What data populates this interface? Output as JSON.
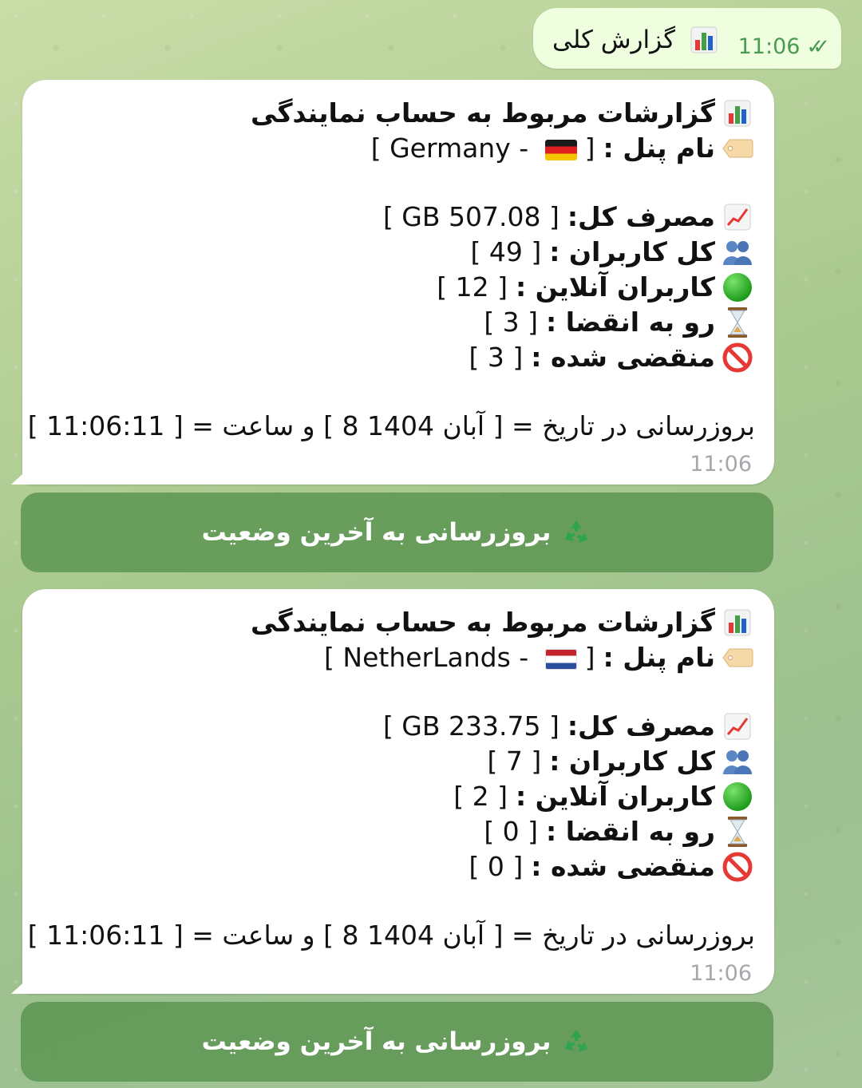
{
  "outgoing": {
    "text": "گزارش کلی",
    "icon": "bar-chart-icon",
    "time": "11:06",
    "status": "read-double-check"
  },
  "reports": [
    {
      "title": "گزارشات مربوط به حساب نمایندگی",
      "panel_label": "نام پنل :",
      "panel_name": "[ Germany - 🇩🇪 ]",
      "panel_country": "Germany",
      "panel_flag": "flag-germany-icon",
      "usage_label": "مصرف کل:",
      "usage_value": "[ GB 507.08 ]",
      "users_label": "کل کاربران :",
      "users_value": "[ 49 ]",
      "online_label": "کاربران آنلاین :",
      "online_value": "[ 12 ]",
      "expiring_label": "رو به انقضا :",
      "expiring_value": "[ 3 ]",
      "expired_label": "منقضی شده :",
      "expired_value": "[ 3 ]",
      "update_prefix": "بروزرسانی در تاریخ =",
      "update_date": "[ 8 آبان 1404 ]",
      "update_mid": "و ساعت =",
      "update_time": "[ 11:06:11 ]",
      "time": "11:06",
      "button_label": "بروزرسانی به آخرین وضعیت"
    },
    {
      "title": "گزارشات مربوط به حساب نمایندگی",
      "panel_label": "نام پنل :",
      "panel_name": "[ NetherLands - 🇳🇱 ]",
      "panel_country": "NetherLands",
      "panel_flag": "flag-netherlands-icon",
      "usage_label": "مصرف کل:",
      "usage_value": "[ GB 233.75 ]",
      "users_label": "کل کاربران :",
      "users_value": "[ 7 ]",
      "online_label": "کاربران آنلاین :",
      "online_value": "[ 2 ]",
      "expiring_label": "رو به انقضا :",
      "expiring_value": "[ 0 ]",
      "expired_label": "منقضی شده :",
      "expired_value": "[ 0 ]",
      "update_prefix": "بروزرسانی در تاریخ =",
      "update_date": "[ 8 آبان 1404 ]",
      "update_mid": "و ساعت =",
      "update_time": "[ 11:06:11 ]",
      "time": "11:06",
      "button_label": "بروزرسانی به آخرین وضعیت"
    }
  ],
  "colors": {
    "bubble_out": "#eefedf",
    "bubble_in": "#ffffff",
    "button_bg": "#5e9654",
    "meta_green": "#4a9a52"
  }
}
